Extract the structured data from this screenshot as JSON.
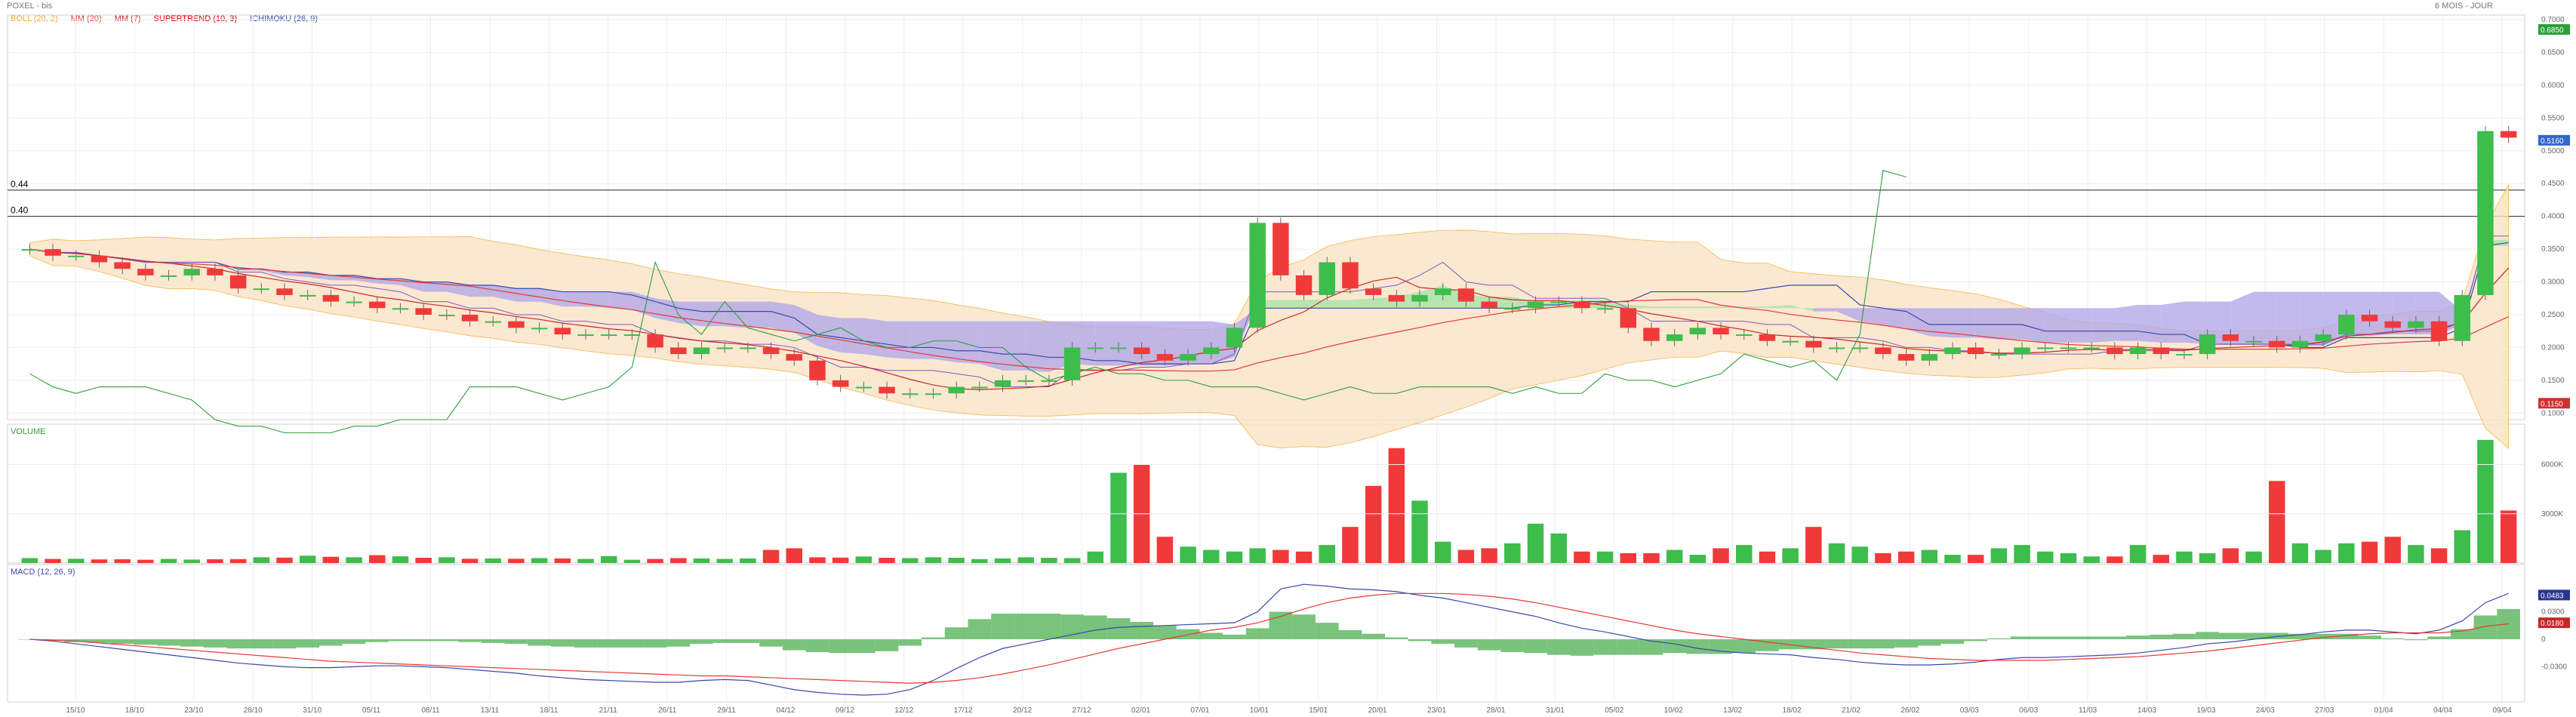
{
  "header": {
    "title": "POXEL - bis",
    "period": "6 MOIS - JOUR"
  },
  "legend": [
    {
      "label": "BOLL (20, 2)",
      "color": "#f5a623"
    },
    {
      "label": "MM (20)",
      "color": "#e53935"
    },
    {
      "label": "MM (7)",
      "color": "#c62828"
    },
    {
      "label": "SUPERTREND (10, 3)",
      "color": "#d50000"
    },
    {
      "label": "ICHIMOKU (26, 9)",
      "color": "#3949ab"
    }
  ],
  "volume_title": "VOLUME",
  "macd_title": "MACD (12, 26, 9)",
  "colors": {
    "up": "#3dbd4c",
    "down": "#f03a3a",
    "cloud_bull": "#a8e2a8",
    "cloud_bear": "#b3a8e8",
    "boll": "#fbe3c6"
  },
  "chart_data": {
    "type": "candlestick",
    "x_labels": [
      "15/10",
      "18/10",
      "23/10",
      "28/10",
      "31/10",
      "05/11",
      "08/11",
      "13/11",
      "18/11",
      "21/11",
      "26/11",
      "29/11",
      "04/12",
      "09/12",
      "12/12",
      "17/12",
      "20/12",
      "27/12",
      "02/01",
      "07/01",
      "10/01",
      "15/01",
      "20/01",
      "23/01",
      "28/01",
      "31/01",
      "05/02",
      "10/02",
      "13/02",
      "18/02",
      "21/02",
      "26/02",
      "03/03",
      "06/03",
      "11/03",
      "14/03",
      "19/03",
      "24/03",
      "27/03",
      "01/04",
      "04/04",
      "09/04"
    ],
    "price_axis": {
      "ylim": [
        0.09,
        0.7
      ],
      "ticks": [
        "0.7000",
        "0.6500",
        "0.6000",
        "0.5500",
        "0.5000",
        "0.4500",
        "0.4000",
        "0.3500",
        "0.3000",
        "0.2500",
        "0.2000",
        "0.1500",
        "0.1000"
      ]
    },
    "price_badges": [
      {
        "label": "0.6850",
        "value": 0.685,
        "color": "#2e9e3a"
      },
      {
        "label": "0.5160",
        "value": 0.516,
        "color": "#3366cc"
      },
      {
        "label": "0.1150",
        "value": 0.115,
        "color": "#d32f2f"
      }
    ],
    "hlines": [
      {
        "label": "0.44",
        "value": 0.44
      },
      {
        "label": "0.40",
        "value": 0.4
      }
    ],
    "series": {
      "close": [
        0.35,
        0.34,
        0.34,
        0.33,
        0.32,
        0.31,
        0.31,
        0.32,
        0.31,
        0.29,
        0.29,
        0.28,
        0.28,
        0.27,
        0.27,
        0.26,
        0.26,
        0.25,
        0.25,
        0.24,
        0.24,
        0.23,
        0.23,
        0.22,
        0.22,
        0.22,
        0.22,
        0.2,
        0.19,
        0.2,
        0.2,
        0.2,
        0.19,
        0.18,
        0.15,
        0.14,
        0.14,
        0.13,
        0.13,
        0.13,
        0.14,
        0.14,
        0.15,
        0.15,
        0.15,
        0.2,
        0.2,
        0.2,
        0.19,
        0.18,
        0.19,
        0.2,
        0.23,
        0.39,
        0.31,
        0.28,
        0.33,
        0.29,
        0.28,
        0.27,
        0.28,
        0.29,
        0.27,
        0.26,
        0.26,
        0.27,
        0.27,
        0.26,
        0.26,
        0.23,
        0.21,
        0.22,
        0.23,
        0.22,
        0.22,
        0.21,
        0.21,
        0.2,
        0.2,
        0.2,
        0.19,
        0.18,
        0.19,
        0.2,
        0.19,
        0.19,
        0.2,
        0.2,
        0.2,
        0.2,
        0.19,
        0.2,
        0.19,
        0.19,
        0.22,
        0.21,
        0.21,
        0.2,
        0.21,
        0.22,
        0.25,
        0.24,
        0.23,
        0.24,
        0.21,
        0.28,
        0.53,
        0.52
      ],
      "volume": [
        300,
        250,
        260,
        220,
        230,
        200,
        250,
        210,
        230,
        240,
        350,
        330,
        450,
        380,
        350,
        480,
        410,
        320,
        350,
        260,
        280,
        260,
        300,
        280,
        250,
        420,
        200,
        250,
        300,
        280,
        250,
        280,
        800,
        900,
        350,
        330,
        400,
        320,
        300,
        350,
        320,
        240,
        280,
        350,
        320,
        300,
        700,
        5500,
        6000,
        1600,
        1000,
        800,
        700,
        900,
        800,
        700,
        1100,
        2200,
        4700,
        7000,
        3800,
        1300,
        800,
        900,
        1200,
        2400,
        1800,
        700,
        700,
        600,
        600,
        800,
        500,
        900,
        1100,
        700,
        900,
        2200,
        1200,
        1000,
        600,
        700,
        800,
        500,
        500,
        900,
        1100,
        700,
        600,
        400,
        400,
        1100,
        500,
        700,
        600,
        900,
        700,
        5000,
        1200,
        800,
        1200,
        1300,
        1600,
        1100,
        900,
        2000,
        7500,
        3200
      ],
      "volume_ticks": [
        "6000K",
        "3000K"
      ],
      "macd": [
        0.0,
        -0.002,
        -0.005,
        -0.008,
        -0.011,
        -0.014,
        -0.017,
        -0.02,
        -0.023,
        -0.026,
        -0.028,
        -0.03,
        -0.031,
        -0.031,
        -0.03,
        -0.029,
        -0.029,
        -0.03,
        -0.031,
        -0.033,
        -0.035,
        -0.037,
        -0.04,
        -0.042,
        -0.044,
        -0.045,
        -0.046,
        -0.047,
        -0.047,
        -0.045,
        -0.044,
        -0.045,
        -0.05,
        -0.055,
        -0.058,
        -0.06,
        -0.061,
        -0.06,
        -0.055,
        -0.045,
        -0.032,
        -0.02,
        -0.01,
        -0.005,
        0.0,
        0.005,
        0.01,
        0.013,
        0.014,
        0.015,
        0.016,
        0.017,
        0.018,
        0.03,
        0.055,
        0.06,
        0.058,
        0.055,
        0.054,
        0.052,
        0.048,
        0.045,
        0.04,
        0.035,
        0.03,
        0.025,
        0.018,
        0.012,
        0.008,
        0.003,
        -0.002,
        -0.005,
        -0.01,
        -0.013,
        -0.015,
        -0.016,
        -0.017,
        -0.02,
        -0.022,
        -0.025,
        -0.027,
        -0.028,
        -0.028,
        -0.027,
        -0.025,
        -0.022,
        -0.02,
        -0.02,
        -0.019,
        -0.018,
        -0.017,
        -0.015,
        -0.012,
        -0.009,
        -0.005,
        -0.003,
        0.0,
        0.003,
        0.005,
        0.008,
        0.01,
        0.01,
        0.008,
        0.006,
        0.01,
        0.02,
        0.04,
        0.05
      ],
      "macd_signal": [
        0.0,
        -0.001,
        -0.002,
        -0.004,
        -0.006,
        -0.008,
        -0.01,
        -0.012,
        -0.014,
        -0.016,
        -0.018,
        -0.02,
        -0.022,
        -0.024,
        -0.025,
        -0.026,
        -0.027,
        -0.028,
        -0.029,
        -0.03,
        -0.031,
        -0.032,
        -0.033,
        -0.034,
        -0.035,
        -0.036,
        -0.037,
        -0.038,
        -0.039,
        -0.04,
        -0.04,
        -0.041,
        -0.042,
        -0.043,
        -0.044,
        -0.045,
        -0.046,
        -0.047,
        -0.048,
        -0.047,
        -0.045,
        -0.042,
        -0.038,
        -0.033,
        -0.028,
        -0.022,
        -0.016,
        -0.01,
        -0.005,
        0.0,
        0.005,
        0.01,
        0.013,
        0.018,
        0.025,
        0.033,
        0.04,
        0.045,
        0.048,
        0.05,
        0.05,
        0.05,
        0.049,
        0.047,
        0.044,
        0.04,
        0.035,
        0.03,
        0.025,
        0.02,
        0.015,
        0.01,
        0.006,
        0.003,
        0.0,
        -0.003,
        -0.006,
        -0.009,
        -0.012,
        -0.015,
        -0.017,
        -0.019,
        -0.021,
        -0.022,
        -0.023,
        -0.023,
        -0.023,
        -0.023,
        -0.022,
        -0.021,
        -0.02,
        -0.019,
        -0.017,
        -0.015,
        -0.013,
        -0.01,
        -0.007,
        -0.004,
        -0.001,
        0.002,
        0.004,
        0.006,
        0.007,
        0.007,
        0.007,
        0.009,
        0.014,
        0.017
      ],
      "macd_ticks": [
        "0.0300",
        "0",
        "-0.0300"
      ],
      "macd_badges": [
        {
          "label": "0.0483",
          "value": 0.0483,
          "color": "#283593"
        },
        {
          "label": "0.0180",
          "value": 0.018,
          "color": "#c62828"
        }
      ]
    }
  }
}
